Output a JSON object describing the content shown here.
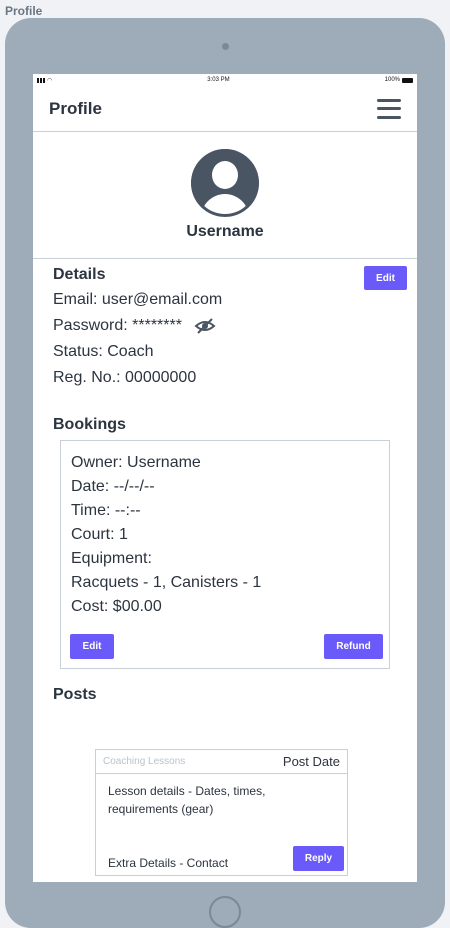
{
  "page_label": "Profile",
  "statusbar": {
    "time": "3:03 PM",
    "battery": "100%"
  },
  "header": {
    "title": "Profile"
  },
  "profile": {
    "username": "Username"
  },
  "details": {
    "title": "Details",
    "edit_label": "Edit",
    "email": "Email: user@email.com",
    "password": "Password: ********",
    "status": "Status: Coach",
    "reg_no": "Reg. No.: 00000000"
  },
  "bookings": {
    "title": "Bookings",
    "lines": [
      "Owner: Username",
      "Date: --/--/--",
      "Time: --:--",
      "Court: 1",
      "Equipment:",
      "Racquets - 1, Canisters - 1",
      "Cost: $00.00"
    ],
    "edit_label": "Edit",
    "refund_label": "Refund"
  },
  "posts": {
    "title": "Posts",
    "category": "Coaching Lessons",
    "date": "Post Date",
    "body": "Lesson details - Dates, times, requirements (gear)",
    "extra": "Extra Details - Contact",
    "reply_label": "Reply"
  },
  "colors": {
    "accent": "#6a5af9",
    "device": "#9eabb8",
    "text": "#2c3440"
  },
  "icons": {
    "menu": "hamburger-menu-icon",
    "avatar": "user-avatar-icon",
    "password_visibility": "eye-slash-icon"
  }
}
